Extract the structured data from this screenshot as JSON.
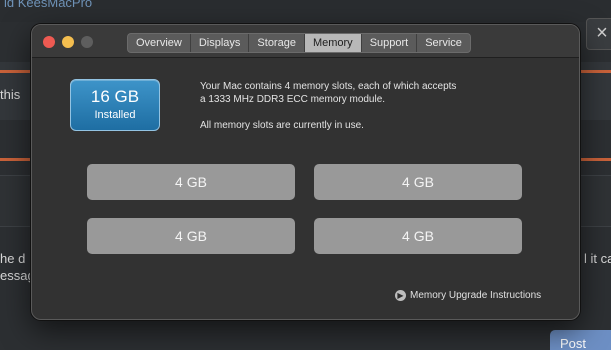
{
  "background": {
    "title": "id KeesMacPro",
    "left_text_1": "this",
    "left_text_2": "he d",
    "left_text_3": "essag",
    "right_text": "l it ca",
    "close_glyph": "×",
    "button_label": "Post"
  },
  "window": {
    "tabs": [
      {
        "label": "Overview"
      },
      {
        "label": "Displays"
      },
      {
        "label": "Storage"
      },
      {
        "label": "Memory",
        "active": true
      },
      {
        "label": "Support"
      },
      {
        "label": "Service"
      }
    ],
    "badge": {
      "size": "16 GB",
      "label": "Installed"
    },
    "info": {
      "line1": "Your Mac contains 4 memory slots, each of which accepts",
      "line2": "a 1333 MHz DDR3 ECC memory module.",
      "line3": "All memory slots are currently in use."
    },
    "slots": [
      "4 GB",
      "4 GB",
      "4 GB",
      "4 GB"
    ],
    "upgrade_link": "Memory Upgrade Instructions"
  },
  "colors": {
    "badge": "#2a7db5",
    "slot": "#999999",
    "close": "#ee5a52",
    "minimize": "#f4be4f",
    "zoom_disabled": "#5e5e5e"
  }
}
